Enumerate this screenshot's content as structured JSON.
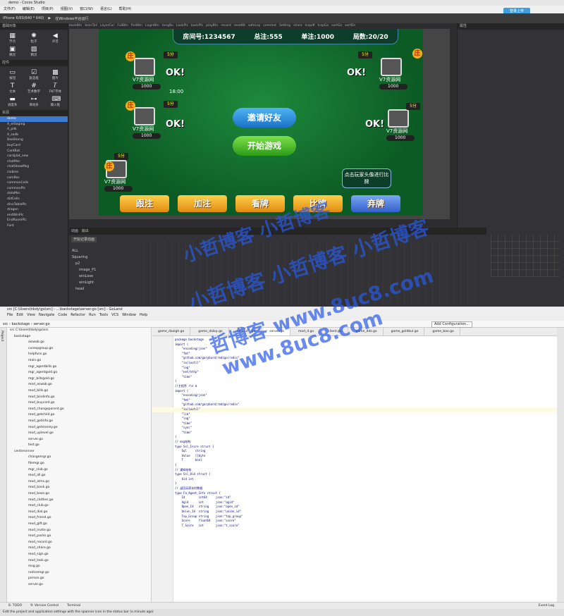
{
  "cocos": {
    "title": "demo - Cocos Studio",
    "menu": [
      "文件(F)",
      "编辑(E)",
      "项目(P)",
      "视图(V)",
      "窗口(W)",
      "语言(L)",
      "帮助(H)"
    ],
    "login": "登录上传",
    "device": "iPhone 6/6S(640 * 640)",
    "platform": "在Windows平台运行",
    "panels": {
      "base": "基础对象",
      "controls": "控件",
      "resources": "资源",
      "props": "属性",
      "timeline": "动画",
      "output": "输出"
    },
    "base_items": [
      "节点",
      "粒子",
      "声音",
      "精灵",
      "精灵"
    ],
    "control_items": [
      "按钮",
      "复选框",
      "图片",
      "文本",
      "艺术数字",
      "FNT字体",
      "进度条",
      "滑动条",
      "输入框"
    ],
    "tree": [
      "demo",
      "A_erbaging",
      "A_pdk",
      "A_sadb",
      "BaoShang",
      "buyCard",
      "CardBat",
      "cardplat_new",
      "chatMsc",
      "chatShowMsg",
      "clubres",
      "comRes",
      "commonCells",
      "commonPlc",
      "dataMsc",
      "didCells",
      "dinoTablePlc",
      "dragon",
      "endWinPlc",
      "EndRoomPlc",
      "Font"
    ],
    "tabs": [
      "backBtn",
      "bossTail",
      "LayerCur",
      "FullBtn",
      "findBtn",
      "LoginBtn",
      "tongBu",
      "LookPlc",
      "backPlc",
      "playBtn",
      "record",
      "resetBt",
      "safeLay",
      "commnt",
      "Setting",
      "share",
      "tcspdf",
      "tcspGo",
      "sortGo",
      "sortDir"
    ],
    "game": {
      "room": "房间号:1234567",
      "total": "总注:555",
      "single": "单注:1000",
      "rounds": "局数:20/20",
      "player_name": "V7资源网",
      "coins": "1000",
      "timer": "18:00",
      "zhuang": "庄",
      "fen": "5分",
      "ok": "OK!",
      "invite": "邀请好友",
      "start": "开始游戏",
      "tip": "点击玩家头像进行比牌",
      "actions": [
        "跟注",
        "加注",
        "看牌",
        "比牌",
        "弃牌"
      ]
    },
    "anim": {
      "start_btn": "开始记录动画",
      "all": "ALL",
      "nodes": [
        "Squaring",
        "p2",
        "image_P1",
        "winLose",
        "winLight",
        "head"
      ]
    },
    "watermarks": [
      "小哲博客 小哲博客",
      "小哲博客 小哲博客 小哲博客",
      "哲博客 www.8uc8.com",
      "www.8uc8.com"
    ]
  },
  "goland": {
    "menu_top": "src [C:\\Users\\hbdy\\go\\src] - ...\\backstage\\server.go [src] - GoLand",
    "menu": [
      "File",
      "Edit",
      "View",
      "Navigate",
      "Code",
      "Refactor",
      "Run",
      "Tools",
      "VCS",
      "Window",
      "Help"
    ],
    "crumb": [
      "src",
      "backstage",
      "server.go"
    ],
    "add_config": "Add Configuration...",
    "project_label": "Project",
    "tabs": [
      "game_daxigh.go",
      "game_daikp.go",
      "helpfuns.go",
      "server.go",
      "mod_d.go",
      "client.go",
      "game_ddz.go",
      "game_goldbul.go",
      "game_bao.go"
    ],
    "tree": [
      "src C:\\Users\\hbdy\\go\\src",
      "backstage",
      "aiswab.go",
      "curespgroup.go",
      "helpfuns.go",
      "main.go",
      "mgr_agentbills.go",
      "mgr_agentgold.go",
      "mgr_billsgold.go",
      "mod_aswab.go",
      "mod_bills.go",
      "mod_bindinfo.go",
      "mod_buycard.go",
      "mod_changeparent.go",
      "mod_getchild.go",
      "mod_getinfo.go",
      "mod_getmoney.go",
      "mod_uplevel.go",
      "server.go",
      "test.go",
      "centerserver",
      "changemgr.go",
      "filemgr.go",
      "mgr_club.go",
      "mod_all.go",
      "mod_alms.go",
      "mod_bank.go",
      "mod_base.go",
      "mod_clothes.go",
      "mod_club.go",
      "mod_dial.go",
      "mod_friend.go",
      "mod_gift.go",
      "mod_invite.go",
      "mod_packs.go",
      "mod_record.go",
      "mod_share.go",
      "mod_sign.go",
      "mod_task.go",
      "msg.go",
      "noticemgr.go",
      "person.go",
      "server.go"
    ],
    "code": [
      "package backstage",
      "",
      "import (",
      "    \"encoding/json\"",
      "    \"fmt\"",
      "    \"github.com/garyburd/redigo/redis\"",
      "    \"io/ioutil\"",
      "    \"log\"",
      "    \"net/http\"",
      "    \"time\"",
      ")",
      "",
      "//主程序 r\\n m",
      "import (",
      "    \"encoding/json\"",
      "    \"fmt\"",
      "    \"github.com/garyburd/redigo/redis\"",
      "    \"io/ioutil\"",
      "    \"lib\"",
      "    \"log\"",
      "    \"time\"",
      "    \"sync\"",
      "    \"time\"",
      ")",
      "",
      "// msg结构",
      "type Ssl_Incre struct {",
      "    Sql     string",
      "    Value   []byte",
      "    T       bool",
      "}",
      "",
      "// 通知结构",
      "type Ssl_Did struct {",
      "    Uid int",
      "}",
      "",
      "// 返回玩家实时数据",
      "type Fa_Agent_Info struct {",
      "    Id        int64     json:\"id\"",
      "    Agid      int       json:\"agid\"",
      "    Open_Id   string    json:\"open_id\"",
      "    Union_Id  string    json:\"union_id\"",
      "    Top_Group string    json:\"top_group\"",
      "    Score     float64   json:\"score\"",
      "    T_Score   int       json:\"t_score\""
    ],
    "bottom": [
      "6: TODO",
      "9: Version Control",
      "Terminal"
    ],
    "event_log": "Event Log",
    "status": "Edit the project and application settings with the spanner icon in the status bar (a minute ago)"
  }
}
